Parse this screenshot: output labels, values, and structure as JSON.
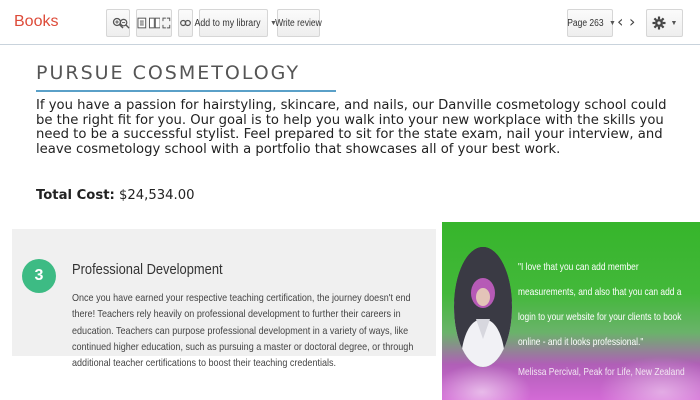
{
  "toolbar": {
    "brand": "Books",
    "add_to_library_label": "Add to my library",
    "write_review_label": "Write review",
    "page_label": "Page 263"
  },
  "main": {
    "title": "PURSUE COSMETOLOGY",
    "intro": "If you have a passion for hairstyling, skincare, and nails, our Danville cosmetology school could be the right fit for you. Our goal is to help you walk into your new workplace with the skills you need to be a successful stylist. Feel prepared to sit for the state exam, nail your interview, and leave cosmetology school with a portfolio that showcases all of your best work.",
    "total_label": "Total Cost:",
    "total_value": "$24,534.00"
  },
  "step": {
    "number": "3",
    "title": "Professional Development",
    "body": "Once you have earned your respective teaching certification, the journey doesn't end there! Teachers rely heavily on professional development to further their careers in education. Teachers can purpose professional development in a variety of ways, like continued higher education, such as pursuing a master or doctoral degree, or through additional teacher certifications to boost their teaching credentials."
  },
  "testimonial": {
    "quote": "\"I love that you can add member measurements, and also that you can add a login to your website for your clients to book online - and it looks professional.\"",
    "author": "Melissa Percival, Peak for Life, New Zealand"
  },
  "colors": {
    "brand": "#dd4b39",
    "step_circle": "#3dbb84",
    "title_rule": "#5aa0c8"
  }
}
